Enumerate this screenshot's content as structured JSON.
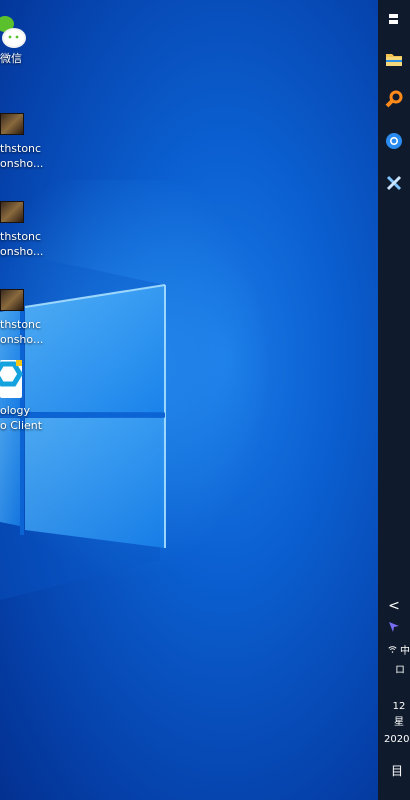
{
  "desktop": {
    "icons": [
      {
        "line1": "微信",
        "line2": ""
      },
      {
        "line1": "thstonc",
        "line2": "onsho..."
      },
      {
        "line1": "thstonc",
        "line2": "onsho..."
      },
      {
        "line1": "thstonc",
        "line2": "onsho..."
      },
      {
        "line1": "ology",
        "line2": "o Client"
      }
    ]
  },
  "taskbar": {
    "tray": {
      "chevron": "<",
      "ime": "中",
      "ime2": "ロ",
      "time": "12",
      "weekday": "星",
      "date": "2020",
      "notification": "目"
    }
  },
  "colors": {
    "taskbar_bg": "#0f1b2c",
    "wechat_green": "#5ac12c",
    "cloud_cyan": "#15a3e0"
  }
}
